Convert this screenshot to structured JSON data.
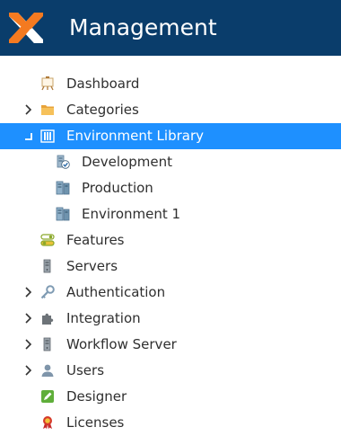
{
  "header": {
    "title": "Management",
    "logo_icon": "x-logo-icon",
    "background_color": "#0a3d6b"
  },
  "tree": {
    "selected_color": "#1e90ff",
    "items": [
      {
        "label": "Dashboard",
        "icon": "easel-icon",
        "expandable": false,
        "level": 0
      },
      {
        "label": "Categories",
        "icon": "folder-icon",
        "expandable": true,
        "expanded": false,
        "level": 0
      },
      {
        "label": "Environment Library",
        "icon": "building-icon",
        "expandable": true,
        "expanded": true,
        "selected": true,
        "level": 0
      },
      {
        "label": "Development",
        "icon": "checked-server-icon",
        "expandable": false,
        "level": 1
      },
      {
        "label": "Production",
        "icon": "server-rack-icon",
        "expandable": false,
        "level": 1
      },
      {
        "label": "Environment 1",
        "icon": "server-rack-icon",
        "expandable": false,
        "level": 1
      },
      {
        "label": "Features",
        "icon": "toggles-icon",
        "expandable": false,
        "level": 0
      },
      {
        "label": "Servers",
        "icon": "server-icon",
        "expandable": false,
        "level": 0
      },
      {
        "label": "Authentication",
        "icon": "key-icon",
        "expandable": true,
        "expanded": false,
        "level": 0
      },
      {
        "label": "Integration",
        "icon": "puzzle-icon",
        "expandable": true,
        "expanded": false,
        "level": 0
      },
      {
        "label": "Workflow Server",
        "icon": "server-icon",
        "expandable": true,
        "expanded": false,
        "level": 0
      },
      {
        "label": "Users",
        "icon": "user-icon",
        "expandable": true,
        "expanded": false,
        "level": 0
      },
      {
        "label": "Designer",
        "icon": "pencil-icon",
        "expandable": false,
        "level": 0
      },
      {
        "label": "Licenses",
        "icon": "award-icon",
        "expandable": false,
        "level": 0
      }
    ]
  }
}
